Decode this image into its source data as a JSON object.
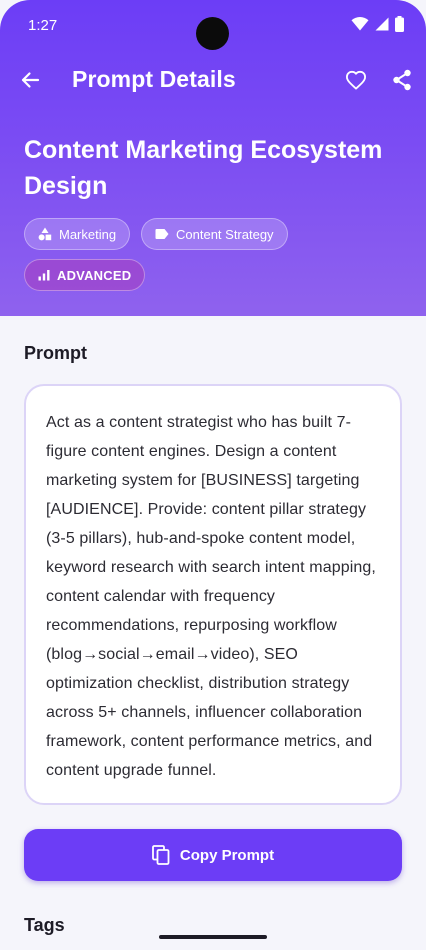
{
  "status_bar": {
    "time": "1:27"
  },
  "appbar": {
    "title": "Prompt Details",
    "icons": {
      "back": "arrow-left-icon",
      "favorite": "heart-outline-icon",
      "share": "share-icon"
    }
  },
  "prompt": {
    "title": "Content Marketing Ecosystem Design",
    "tags": [
      {
        "label": "Marketing",
        "icon": "category-shapes-icon"
      },
      {
        "label": "Content Strategy",
        "icon": "label-tag-icon"
      }
    ],
    "level": {
      "label": "ADVANCED",
      "icon": "signal-bars-icon"
    }
  },
  "sections": {
    "prompt_heading": "Prompt",
    "tags_heading": "Tags"
  },
  "prompt_body": "Act as a content strategist who has built 7-figure content engines. Design a content marketing system for [BUSINESS] targeting [AUDIENCE]. Provide: content pillar strategy (3-5 pillars), hub-and-spoke content model, keyword research with search intent mapping, content calendar with frequency recommendations, repurposing workflow (blog→social→email→video), SEO optimization checklist, distribution strategy across 5+ channels, influencer collaboration framework, content performance metrics, and content upgrade funnel.",
  "copy_button": {
    "label": "Copy Prompt",
    "icon": "copy-icon"
  },
  "colors": {
    "primary": "#6c3df6",
    "header_gradient_end": "#8f62ee",
    "background": "#f5f5fb",
    "card_border": "#dcd4f7",
    "level_badge": "#a83cbe"
  }
}
